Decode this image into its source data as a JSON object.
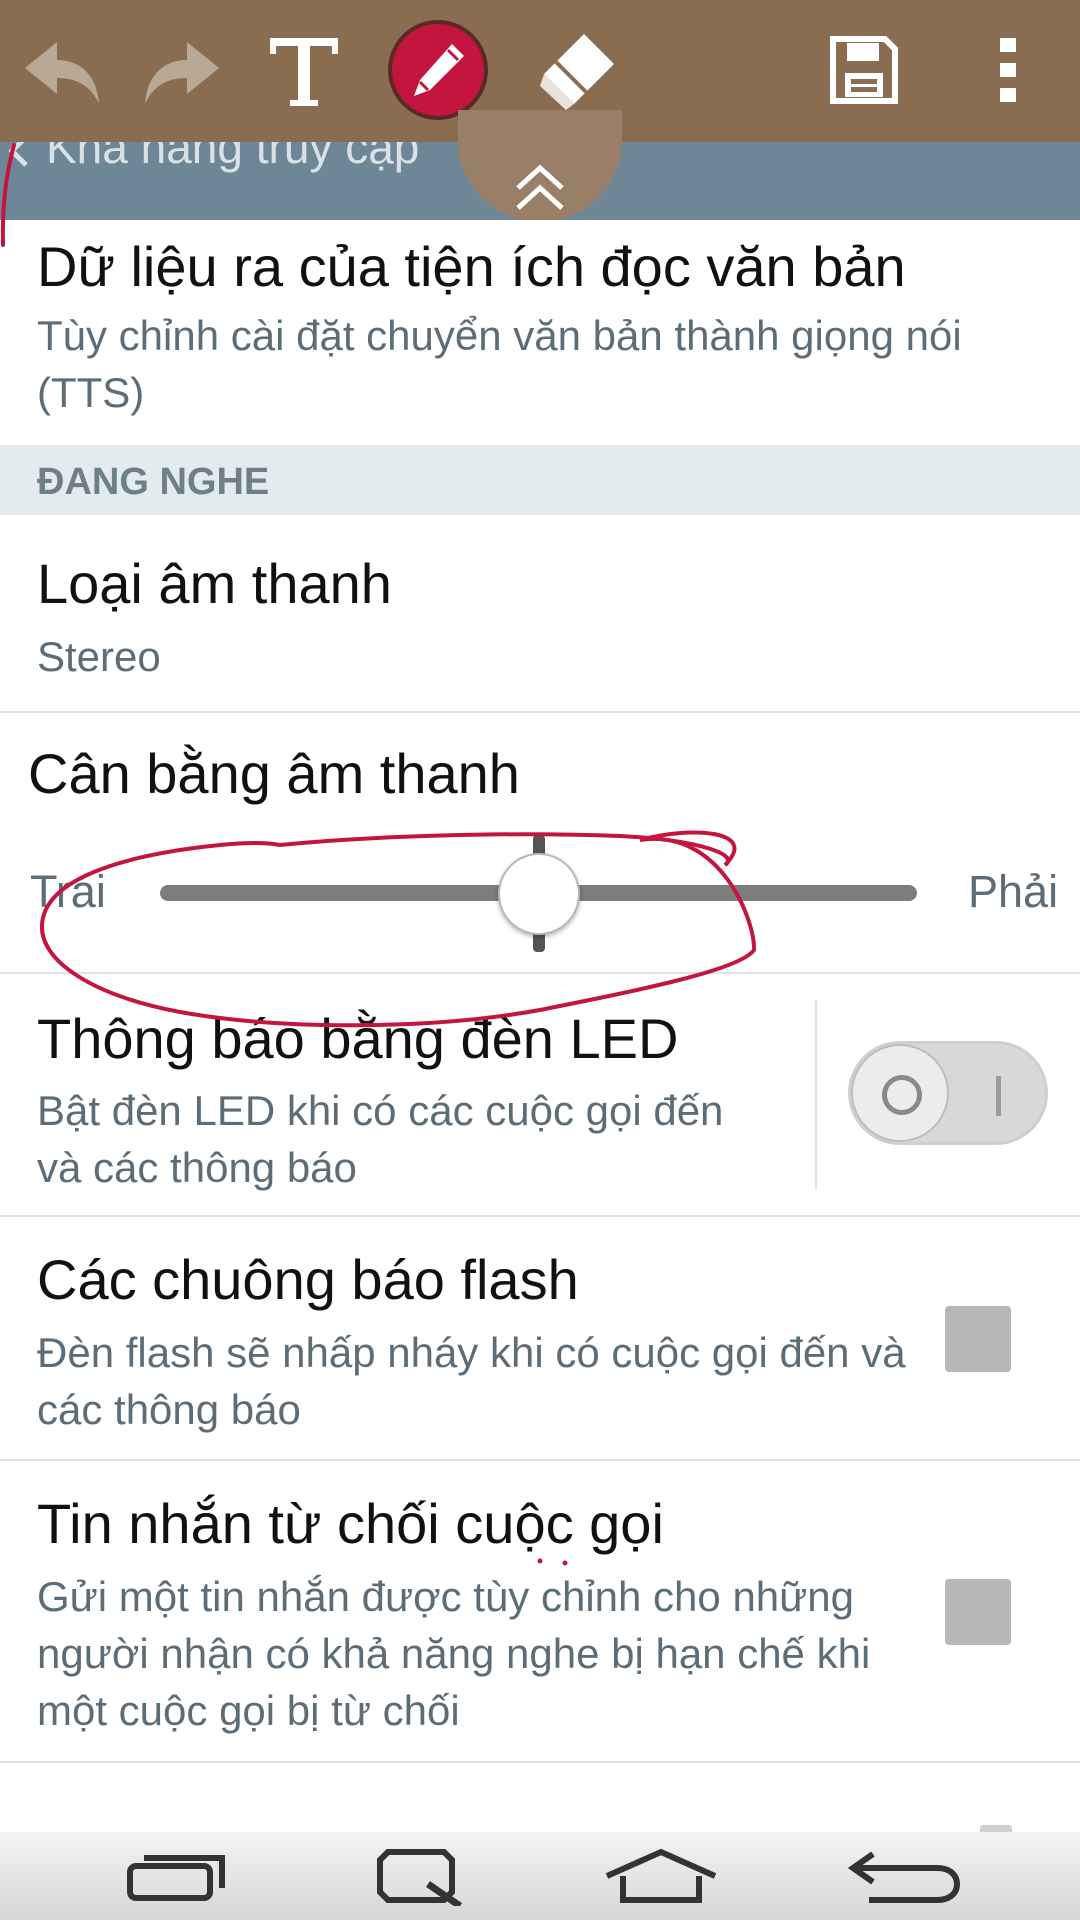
{
  "header": {
    "title": "Khả năng truy cập"
  },
  "toolbar": {
    "buttons": [
      "undo-icon",
      "redo-icon",
      "text-icon",
      "pen-icon",
      "eraser-icon",
      "save-icon",
      "more-icon"
    ],
    "active_tool": "pen",
    "accent_color": "#c4153f",
    "bar_color": "#8a6d51"
  },
  "items": {
    "tts": {
      "title": "Dữ liệu ra của tiện ích đọc văn bản",
      "summary": "Tùy chỉnh cài đặt chuyển văn bản thành giọng nói (TTS)"
    },
    "section_listening": "ĐANG NGHE",
    "sound_type": {
      "title": "Loại âm thanh",
      "summary": "Stereo"
    },
    "sound_balance": {
      "title": "Cân bằng âm thanh",
      "left_label": "Trái",
      "right_label": "Phải",
      "value_fraction": 0.5
    },
    "led_notification": {
      "title": "Thông báo bằng đèn LED",
      "summary": "Bật đèn LED khi có các cuộc gọi đến và các thông báo",
      "enabled": false
    },
    "flash_alerts": {
      "title": "Các chuông báo flash",
      "summary": "Đèn flash sẽ nhấp nháy khi có cuộc gọi đến và các thông báo",
      "checked": false
    },
    "reject_message": {
      "title": "Tin nhắn từ chối cuộc gọi",
      "summary": "Gửi một tin nhắn được tùy chỉnh cho những người nhận có khả năng nghe bị hạn chế khi một cuộc gọi bị từ chối",
      "checked": false
    }
  },
  "navbar": {
    "buttons": [
      "recent-apps-icon",
      "qslide-icon",
      "home-icon",
      "back-icon"
    ]
  },
  "annotation": {
    "stroke_color": "#c4153f"
  }
}
